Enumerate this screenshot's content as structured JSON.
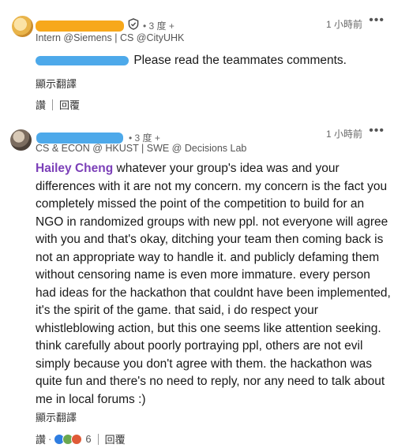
{
  "comment1": {
    "degree": "• 3 度 +",
    "headline": "Intern @Siemens | CS @CityUHK",
    "time": "1 小時前",
    "more": "•••",
    "text": "Please read the teammates comments.",
    "translate": "顯示翻譯",
    "like": "讚",
    "reply": "回覆"
  },
  "comment2": {
    "degree": "• 3 度 +",
    "headline": "CS & ECON @ HKUST | SWE @ Decisions Lab",
    "time": "1 小時前",
    "more": "•••",
    "mention": "Hailey Cheng",
    "text": "whatever your group's idea was and your differences with it are not my concern. my concern is the fact you completely missed the point of the competition to build for an NGO in randomized groups with new ppl. not everyone will agree with you and that's okay, ditching your team then coming back is not an appropriate way to handle it. and publicly defaming them without censoring name is even more immature. every person had ideas for the hackathon that couldnt have been implemented, it's the spirit of the game. that said, i do respect your whistleblowing action, but this one seems like attention seeking. think carefully about poorly portraying ppl, others are not evil simply because you don't agree with them. the hackathon was quite fun and there's no need to reply, nor any need to talk about me in local forums :)",
    "translate": "顯示翻譯",
    "like": "讚",
    "reaction_count": "6",
    "reply": "回覆"
  }
}
